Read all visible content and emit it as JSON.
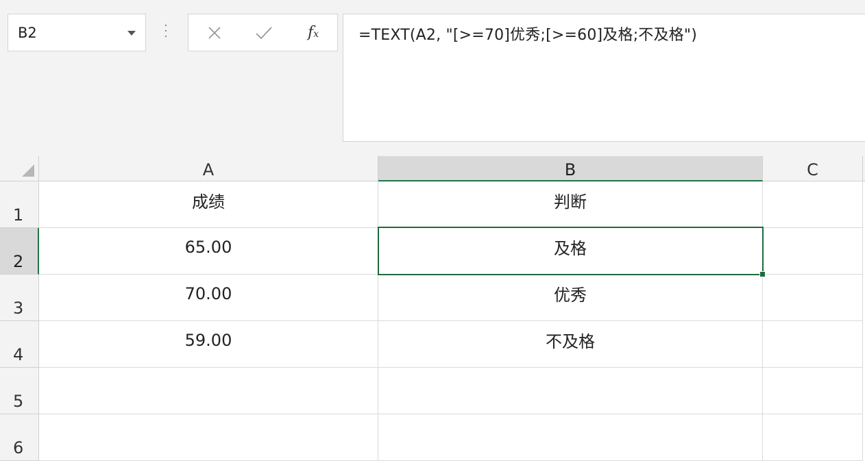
{
  "formula_bar": {
    "name_box": "B2",
    "cancel_icon": "close-icon",
    "enter_icon": "check-icon",
    "fx_label": "f",
    "fx_sub": "x",
    "formula": "=TEXT(A2, \"[>=70]优秀;[>=60]及格;不及格\")"
  },
  "columns": [
    "A",
    "B",
    "C"
  ],
  "rows": [
    "1",
    "2",
    "3",
    "4",
    "5",
    "6"
  ],
  "cells": {
    "A1": "成绩",
    "B1": "判断",
    "A2": "65.00",
    "B2": "及格",
    "A3": "70.00",
    "B3": "优秀",
    "A4": "59.00",
    "B4": "不及格",
    "A5": "",
    "B5": "",
    "A6": "",
    "B6": ""
  },
  "selection": {
    "cell": "B2",
    "accent": "#217346"
  }
}
